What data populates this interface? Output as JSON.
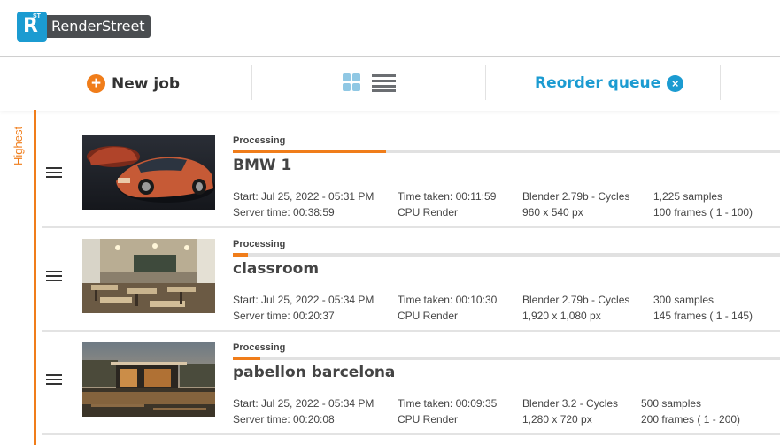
{
  "brand": {
    "logo_mark": "R",
    "logo_superscript": "ST",
    "name": "RenderStreet",
    "accent": "#1b9bd1",
    "orange": "#f07d1a"
  },
  "toolbar": {
    "new_job_label": "New job",
    "new_job_icon": "+",
    "reorder_label": "Reorder queue",
    "reorder_icon": "×"
  },
  "priority_label": "Highest",
  "jobs": [
    {
      "status": "Processing",
      "progress": 0.28,
      "name": "BMW 1",
      "start": "Start: Jul 25, 2022 - 05:31 PM",
      "server_time": "Server time: 00:38:59",
      "time_taken": "Time taken: 00:11:59",
      "render_type": "CPU Render",
      "engine": "Blender 2.79b - Cycles",
      "resolution": "960 x 540 px",
      "samples": "1,225 samples",
      "frames": "100 frames ( 1 - 100)"
    },
    {
      "status": "Processing",
      "progress": 0.027,
      "name": "classroom",
      "start": "Start: Jul 25, 2022 - 05:34 PM",
      "server_time": "Server time: 00:20:37",
      "time_taken": "Time taken: 00:10:30",
      "render_type": "CPU Render",
      "engine": "Blender 2.79b - Cycles",
      "resolution": "1,920 x 1,080 px",
      "samples": "300 samples",
      "frames": "145 frames ( 1 - 145)"
    },
    {
      "status": "Processing",
      "progress": 0.05,
      "name": "pabellon barcelona",
      "start": "Start: Jul 25, 2022 - 05:34 PM",
      "server_time": "Server time: 00:20:08",
      "time_taken": "Time taken: 00:09:35",
      "render_type": "CPU Render",
      "engine": "Blender 3.2 - Cycles",
      "resolution": "1,280 x 720 px",
      "samples": "500 samples",
      "frames": "200 frames ( 1 - 200)"
    }
  ]
}
